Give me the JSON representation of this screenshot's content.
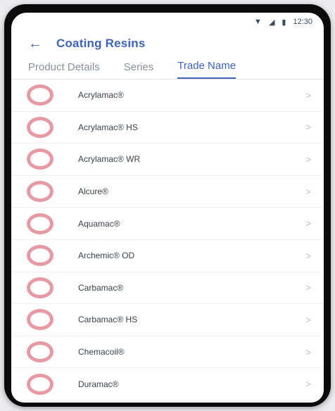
{
  "status_bar": {
    "time": "12:30"
  },
  "app_bar": {
    "title": "Coating Resins"
  },
  "tabs": [
    {
      "label": "Product Details"
    },
    {
      "label": "Series"
    },
    {
      "label": "Trade Name"
    }
  ],
  "items": [
    {
      "label": "Acrylamac®"
    },
    {
      "label": "Acrylamac® HS"
    },
    {
      "label": "Acrylamac® WR"
    },
    {
      "label": "Alcure®"
    },
    {
      "label": "Aquamac®"
    },
    {
      "label": "Archemic® OD"
    },
    {
      "label": "Carbamac®"
    },
    {
      "label": "Carbamac® HS"
    },
    {
      "label": "Chemacoil®"
    },
    {
      "label": "Duramac®"
    }
  ],
  "colors": {
    "accent": "#3e63b8",
    "icon": "#e69aa3"
  }
}
